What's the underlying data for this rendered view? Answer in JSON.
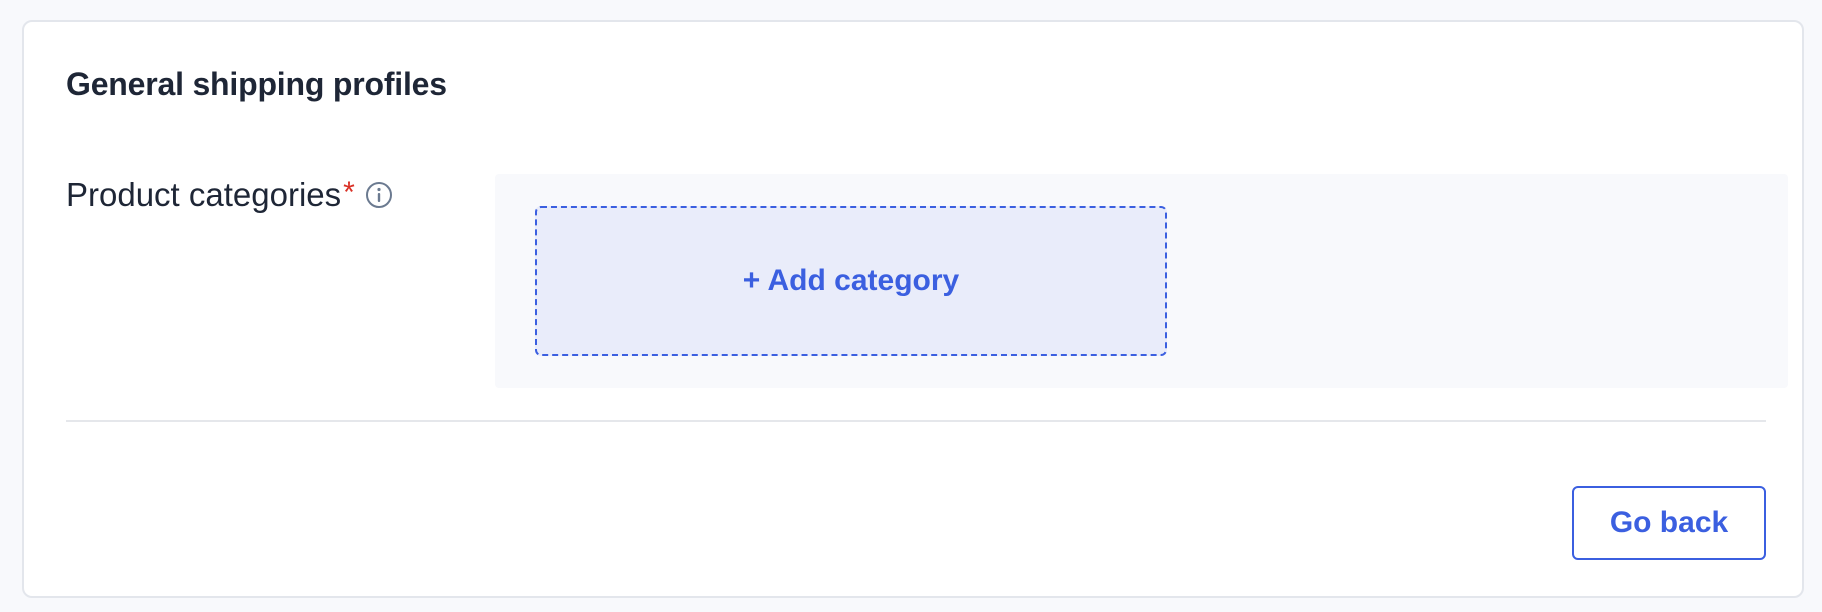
{
  "card": {
    "title": "General shipping profiles"
  },
  "field": {
    "label": "Product categories",
    "required_marker": "*",
    "info_icon": "info-icon"
  },
  "add_category": {
    "label": "+ Add category"
  },
  "actions": {
    "go_back_label": "Go back"
  },
  "colors": {
    "accent": "#3b5fe0",
    "required": "#d93025",
    "title_text": "#1e2636",
    "dropzone_bg": "#e9ecfa",
    "page_bg": "#f8f9fc"
  }
}
